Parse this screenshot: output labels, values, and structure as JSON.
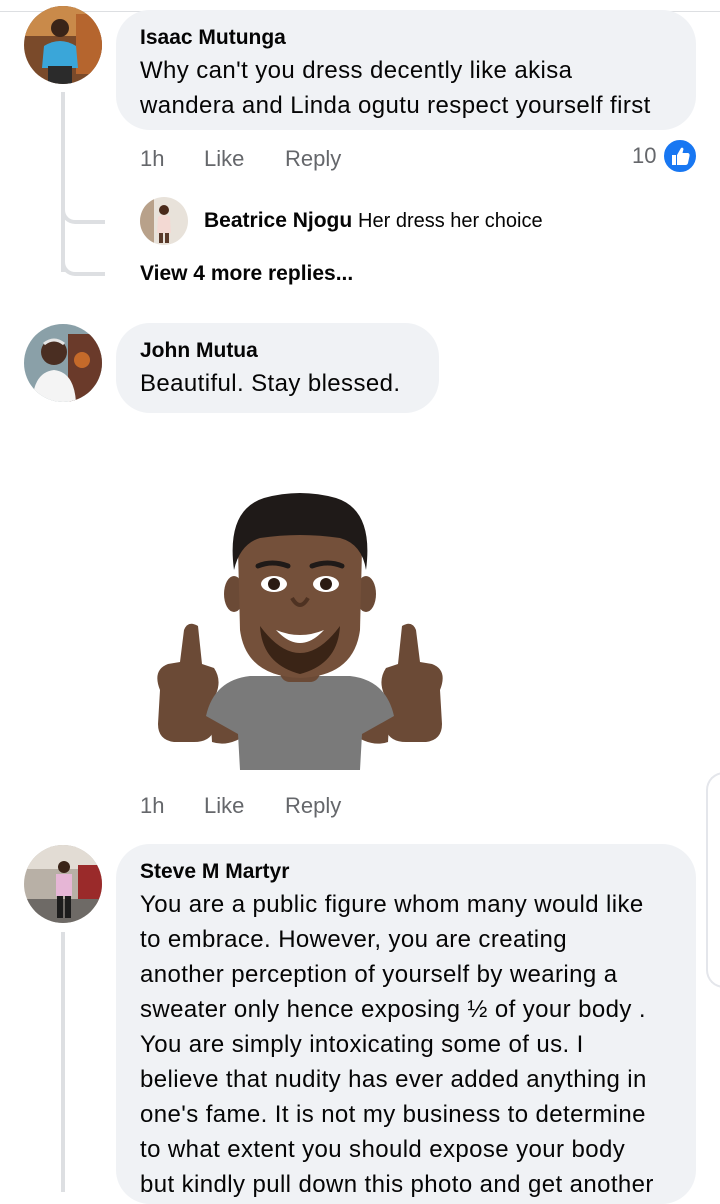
{
  "comments": [
    {
      "author": "Isaac Mutunga",
      "text_lines": [
        "Why can't you dress decently like akisa",
        "wandera and Linda ogutu respect yourself first"
      ],
      "time": "1h",
      "like_label": "Like",
      "reply_label": "Reply",
      "like_count": "10",
      "replies": [
        {
          "author": "Beatrice Njogu",
          "text": "Her dress her choice"
        }
      ],
      "view_more_label": "View 4 more replies..."
    },
    {
      "author": "John Mutua",
      "text_lines": [
        "Beautiful. Stay blessed."
      ],
      "time": "1h",
      "like_label": "Like",
      "reply_label": "Reply",
      "sticker_icon": "thumbs-up-avatar-sticker"
    },
    {
      "author": "Steve M Martyr",
      "text_lines": [
        "You are a public figure whom many would like",
        "to embrace. However, you are creating",
        "another perception of yourself by wearing a",
        "sweater only hence exposing ½ of your body .",
        "You are simply intoxicating some of us. I",
        "believe that nudity has ever added anything in",
        "one's fame. It is not my business to determine",
        "to what extent you should expose your body",
        "but kindly pull down this photo and get another"
      ]
    }
  ],
  "colors": {
    "bubble": "#f0f2f5",
    "meta_text": "#65676b",
    "like_blue": "#1877f2",
    "thread_line": "#dddfe2"
  }
}
